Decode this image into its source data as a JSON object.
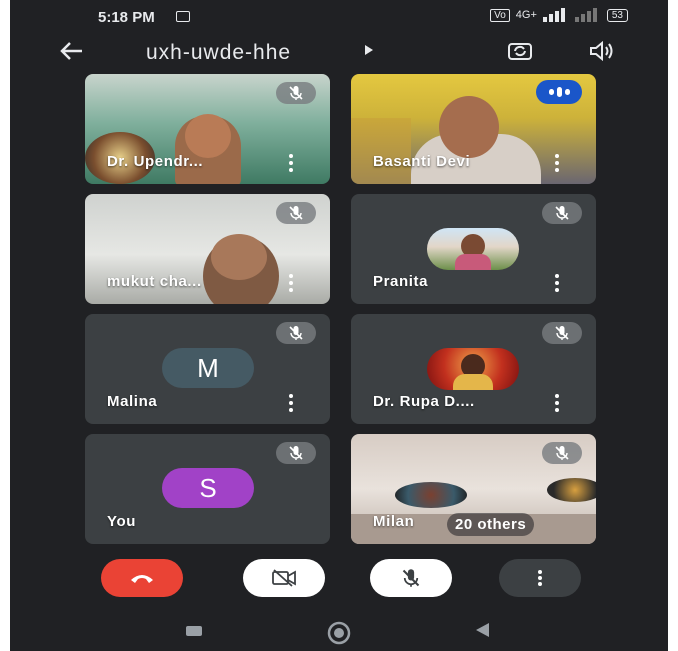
{
  "status_bar": {
    "time": "5:18 PM",
    "network": "4G+",
    "battery": "53"
  },
  "header": {
    "meeting_code": "uxh-uwde-hhe"
  },
  "participants": [
    {
      "name": "Dr. Upendr..."
    },
    {
      "name": "Basanti Devi"
    },
    {
      "name": "mukut cha..."
    },
    {
      "name": "Pranita"
    },
    {
      "name": "Malina",
      "initial": "M"
    },
    {
      "name": "Dr. Rupa D...."
    },
    {
      "name": "You",
      "initial": "S"
    },
    {
      "name": "Milan"
    }
  ],
  "others_label": "20 others",
  "colors": {
    "background": "#202124",
    "tile": "#3c4043",
    "end_call": "#ea4335",
    "avatar_m": "#455a64",
    "avatar_s": "#a142c7",
    "speaking": "#1a56c9"
  },
  "icons": [
    "back-arrow-icon",
    "play-arrow-icon",
    "switch-camera-icon",
    "speaker-icon",
    "mic-off-icon",
    "more-vert-icon",
    "end-call-icon",
    "video-off-icon"
  ]
}
